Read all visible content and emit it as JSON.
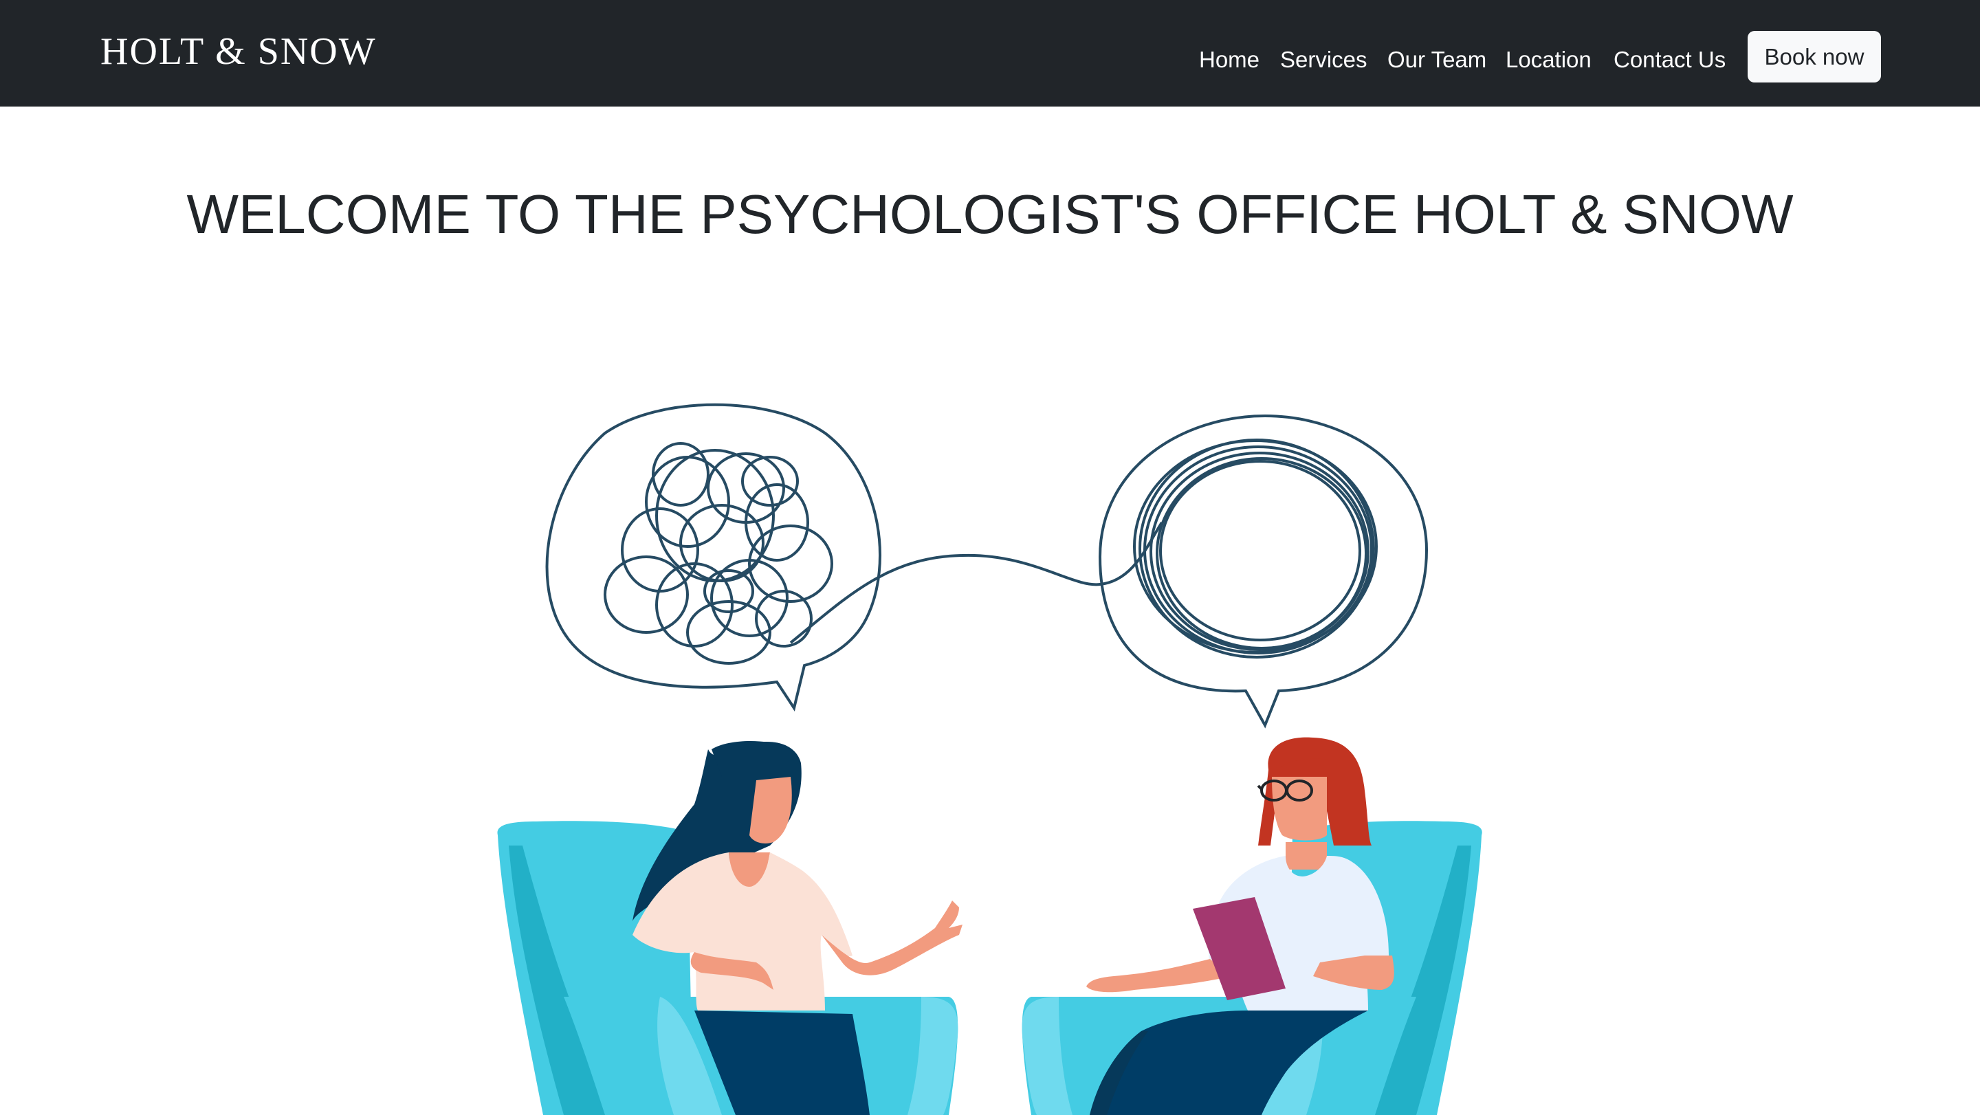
{
  "navbar": {
    "brand": "HOLT & SNOW",
    "links": [
      {
        "label": "Home"
      },
      {
        "label": "Services"
      },
      {
        "label": "Our Team"
      },
      {
        "label": "Location"
      },
      {
        "label": "Contact Us"
      }
    ],
    "cta_label": "Book now"
  },
  "hero": {
    "title": "WELCOME TO THE PSYCHOLOGIST'S OFFICE HOLT & SNOW",
    "illustration": "therapy-session-illustration"
  },
  "colors": {
    "navbar_bg": "#212529",
    "chair": "#44cce3",
    "chair_dark": "#22b0c7",
    "line": "#264b63",
    "hair_client": "#06395a",
    "hair_therapist": "#c23421",
    "skin": "#f29b7f",
    "clipboard": "#a3386f",
    "pants": "#003d66"
  }
}
